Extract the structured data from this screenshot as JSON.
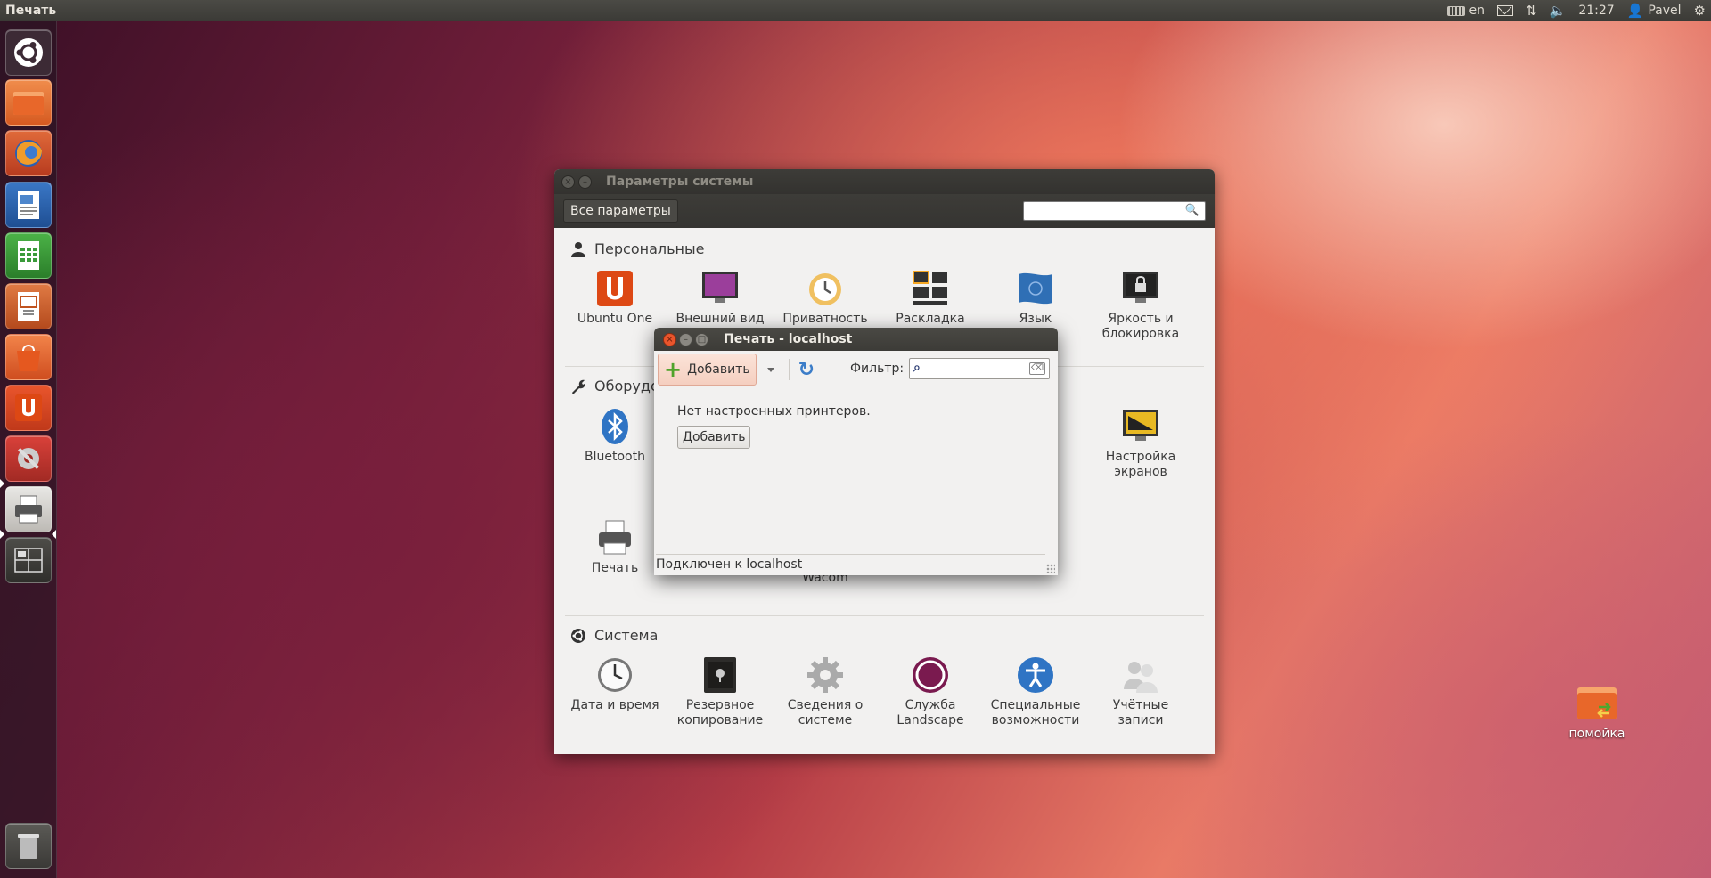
{
  "top_panel": {
    "app_title": "Печать",
    "keyboard_layout": "en",
    "time": "21:27",
    "user": "Pavel"
  },
  "launcher": {
    "items": [
      "dash-home",
      "files",
      "firefox",
      "libreoffice-writer",
      "libreoffice-calc",
      "libreoffice-impress",
      "software-center",
      "ubuntu-one",
      "system-settings",
      "printing",
      "workspace-switcher",
      "trash"
    ]
  },
  "settings_window": {
    "title": "Параметры системы",
    "all_params": "Все параметры",
    "search_placeholder": "",
    "sections": {
      "personal": {
        "label": "Персональные",
        "items": [
          "Ubuntu One",
          "Внешний вид",
          "Приватность",
          "Раскладка",
          "Язык",
          "Яркость и блокировка"
        ]
      },
      "hardware": {
        "label": "Оборудо",
        "items": [
          "Bluetooth",
          "Настройка экранов",
          "Печать",
          "Wacom"
        ]
      },
      "system": {
        "label": "Система",
        "items": [
          "Дата и время",
          "Резервное копирование",
          "Сведения о системе",
          "Служба Landscape",
          "Специальные возможности",
          "Учётные записи"
        ]
      }
    }
  },
  "print_window": {
    "title": "Печать - localhost",
    "add_label": "Добавить",
    "filter_label": "Фильтр:",
    "filter_value": "",
    "no_printers_text": "Нет настроенных принтеров.",
    "add_button_label": "Добавить",
    "status_text": "Подключен к localhost"
  },
  "desktop": {
    "trash_label": "помойка"
  },
  "colors": {
    "panel": "#3b3a36",
    "accent_orange": "#e9552c",
    "window_bg": "#f2f1f0"
  }
}
